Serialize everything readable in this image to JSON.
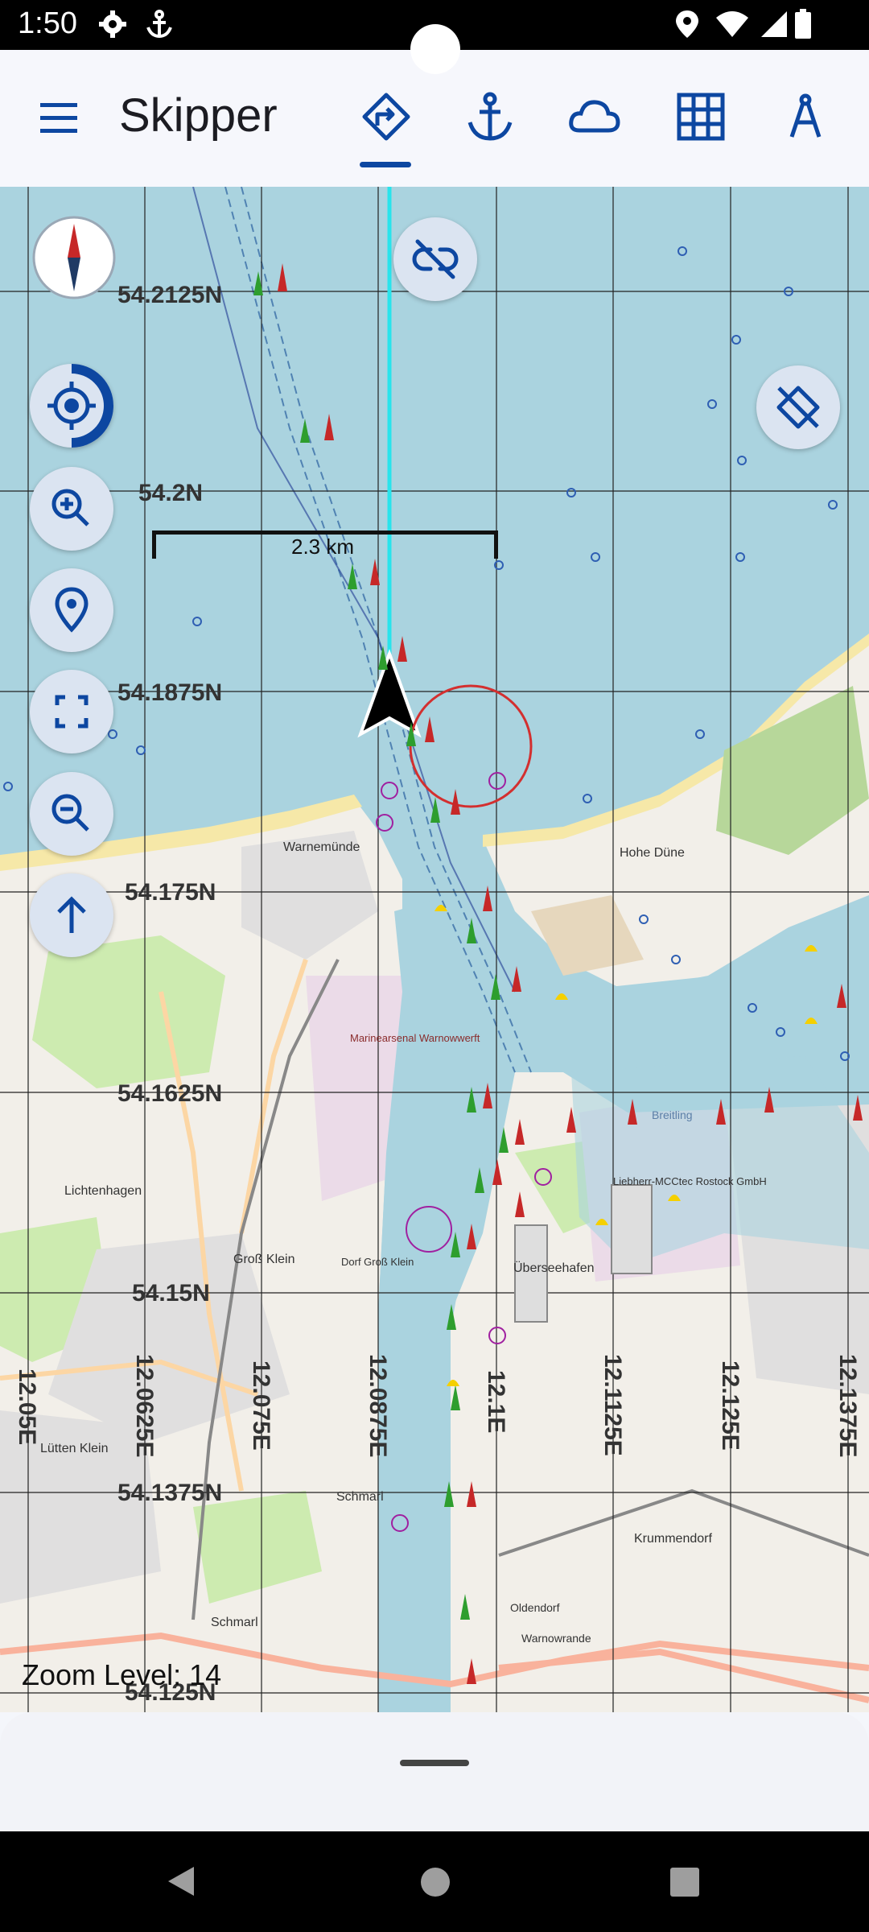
{
  "status_bar": {
    "time": "1:50"
  },
  "app_bar": {
    "title": "Skipper",
    "tabs": [
      "route-icon",
      "anchor-icon",
      "cloud-icon",
      "grid-icon",
      "compass-tool-icon"
    ],
    "selected_tab": 0
  },
  "map": {
    "scale_label": "2.3 km",
    "zoom_text": "Zoom Level: 14",
    "latitudes": [
      "54.2125N",
      "54.2N",
      "54.1875N",
      "54.175N",
      "54.1625N",
      "54.15N",
      "54.1375N",
      "54.125N"
    ],
    "longitudes": [
      "12.05E",
      "12.0625E",
      "12.075E",
      "12.0875E",
      "12.1E",
      "12.1125E",
      "12.125E",
      "12.1375E"
    ],
    "places": {
      "warnemunde": "Warnemünde",
      "hohe_dune": "Hohe Düne",
      "marinearsenal": "Marinearsenal Warnowwerft",
      "lichtenhagen": "Lichtenhagen",
      "gross_klein": "Groß Klein",
      "dorf_gross_klein": "Dorf Groß Klein",
      "ueberseehafen": "Überseehafen",
      "liebherr": "Liebherr-MCCtec Rostock GmbH",
      "schmarl": "Schmarl",
      "lutten_klein": "Lütten Klein",
      "krummendorf": "Krummendorf",
      "oldendorf": "Oldendorf",
      "warnowrande": "Warnowrande",
      "breitling": "Breitling"
    },
    "colors": {
      "water": "#aad3df",
      "land": "#f2efe9",
      "route": "#28e4ec"
    }
  },
  "controls": [
    "compass-icon",
    "locate-icon",
    "zoom-in-icon",
    "place-pin-icon",
    "fullscreen-icon",
    "zoom-out-icon",
    "north-up-icon",
    "unlink-icon",
    "satellite-off-icon"
  ]
}
